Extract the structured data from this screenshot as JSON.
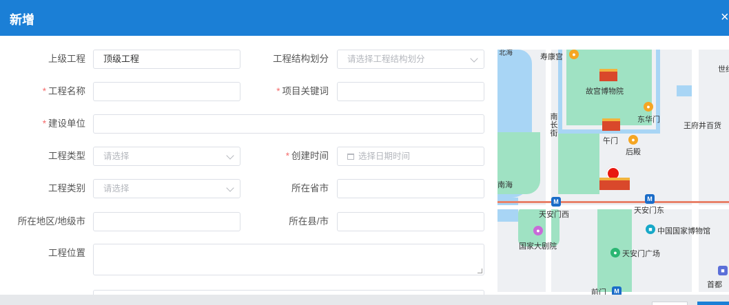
{
  "dialog": {
    "title": "新增",
    "close_icon": "×"
  },
  "form": {
    "parent_project": {
      "label": "上级工程",
      "value": "顶级工程"
    },
    "structure_division": {
      "label": "工程结构划分",
      "placeholder": "请选择工程结构划分"
    },
    "project_name": {
      "label": "工程名称",
      "value": "",
      "required_mark": "*"
    },
    "project_keyword": {
      "label": "项目关键词",
      "value": "",
      "required_mark": "*"
    },
    "construction_unit": {
      "label": "建设单位",
      "value": "",
      "required_mark": "*"
    },
    "project_type": {
      "label": "工程类型",
      "placeholder": "请选择"
    },
    "create_time": {
      "label": "创建时间",
      "placeholder": "选择日期时间",
      "required_mark": "*"
    },
    "project_category": {
      "label": "工程类别",
      "placeholder": "请选择"
    },
    "province": {
      "label": "所在省市",
      "value": ""
    },
    "prefecture": {
      "label": "所在地区/地级市",
      "value": ""
    },
    "county": {
      "label": "所在县/市",
      "value": ""
    },
    "location": {
      "label": "工程位置",
      "value": ""
    }
  },
  "map": {
    "labels": {
      "shouhuang": "寿康宫",
      "north_sea": "北海",
      "palace_museum": "故宫博物院",
      "donghuamen": "东华门",
      "wumen": "午门",
      "houdian": "后殿",
      "wangfujing": "王府井百货",
      "nanchang": "南长街",
      "zhonghai": "南海",
      "tiananmen_west": "天安门西",
      "tiananmen_east": "天安门东",
      "national_museum": "中国国家博物馆",
      "grand_theater": "国家大剧院",
      "tiananmen_square": "天安门广场",
      "qianmen": "前门",
      "capital": "首都",
      "world": "世纪"
    },
    "colors": {
      "water": "#a8d5f5",
      "park": "#9fe2c3",
      "rail": "#e8826a",
      "pin": "#e8170f"
    }
  },
  "colors": {
    "header": "#1b7fd6",
    "required": "#f56c6c"
  }
}
